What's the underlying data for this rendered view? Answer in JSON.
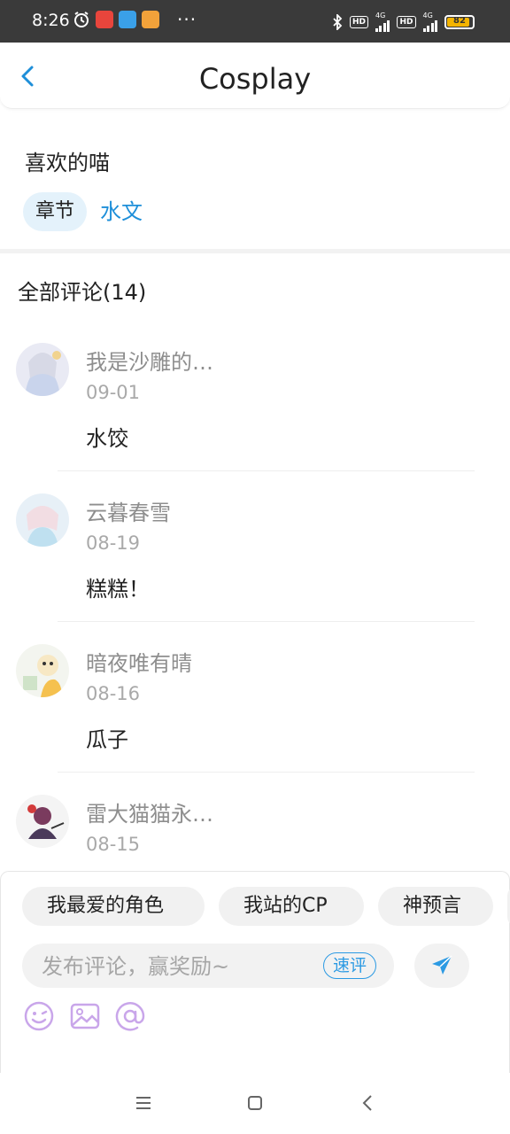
{
  "status_bar": {
    "time": "8:26",
    "overflow": "···",
    "hd1": "HD",
    "net1": "4G",
    "hd2": "HD",
    "net2": "4G",
    "battery": "82",
    "icons": [
      "alarm-icon",
      "app-notification-icon",
      "app-notification-icon",
      "app-notification-icon",
      "bluetooth-icon",
      "signal-icon",
      "signal-icon",
      "battery-icon"
    ]
  },
  "header": {
    "title": "Cosplay",
    "back_icon": "chevron-left-icon"
  },
  "tags": {
    "label": "喜欢的喵",
    "active_chip": "章节",
    "link_chip": "水文"
  },
  "comments": {
    "title": "全部评论(14)",
    "items": [
      {
        "name": "我是沙雕的…",
        "date": "09-01",
        "text": "水饺"
      },
      {
        "name": "云暮春雪",
        "date": "08-19",
        "text": "糕糕！"
      },
      {
        "name": "暗夜唯有晴",
        "date": "08-16",
        "text": "瓜子"
      },
      {
        "name": "雷大猫猫永…",
        "date": "08-15",
        "text": ""
      }
    ]
  },
  "composer": {
    "quick_tags": [
      "我最爱的角色",
      "我站的CP",
      "神预言"
    ],
    "placeholder": "发布评论，赢奖励~",
    "quick_review": "速评",
    "send_icon": "send-icon",
    "tools": [
      "emoji-icon",
      "image-icon",
      "mention-icon"
    ]
  },
  "colors": {
    "accent": "#1e8fd9",
    "chip_bg": "#e4f2fb",
    "tool_purple": "#c9a6ea"
  }
}
